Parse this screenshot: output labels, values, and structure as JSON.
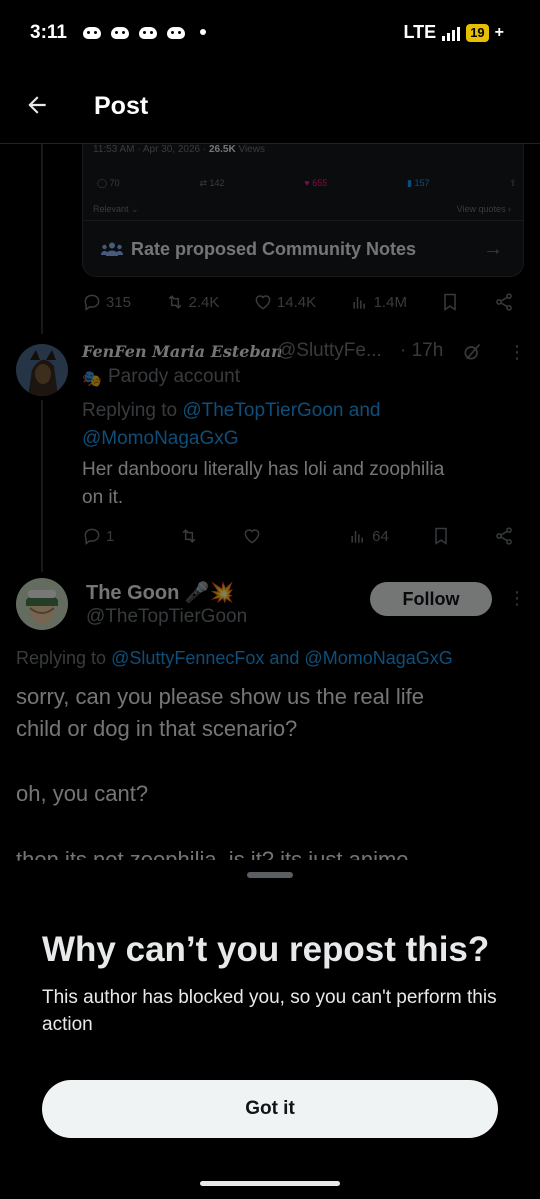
{
  "status_bar": {
    "time": "3:11",
    "network": "LTE",
    "battery": "19",
    "charging": "+"
  },
  "header": {
    "title": "Post"
  },
  "quoted_card": {
    "meta_time": "11:53 AM · Apr 30, 2026 · ",
    "meta_views": "26.5K",
    "meta_views_label": " Views",
    "replies": "70",
    "reposts": "142",
    "likes": "655",
    "bookmarks": "157",
    "relevant": "Relevant ⌄",
    "view_quotes": "View quotes ›",
    "notes_label": "Rate proposed Community Notes"
  },
  "main_post_actions": {
    "replies": "315",
    "reposts": "2.4K",
    "likes": "14.4K",
    "views": "1.4M"
  },
  "reply1": {
    "name": "FenFen Maria Esteban",
    "handle": "@SluttyFe...",
    "time": "· 17h",
    "parody_icon": "🎭",
    "parody_label": "Parody account",
    "replying_prefix": "Replying to ",
    "replying_users": "@TheTopTierGoon and",
    "replying_users2": "@MomoNagaGxG",
    "text_line1": "Her danbooru literally has loli and zoophilia",
    "text_line2": "on it.",
    "replies": "1",
    "views": "64"
  },
  "reply2": {
    "name": "The Goon 🎤💥",
    "handle": "@TheTopTierGoon",
    "follow_label": "Follow",
    "replying_prefix": "Replying to ",
    "replying_users": "@SluttyFennecFox and @MomoNagaGxG",
    "text_line1": "sorry, can you please show us the real life",
    "text_line2": "child or dog in that scenario?",
    "text_line3": "oh, you cant?",
    "text_line4": "then its not zoophilia, is it? its just anime"
  },
  "sheet": {
    "title": "Why can’t you repost this?",
    "body": "This author has blocked you, so you can't perform this action",
    "button": "Got it"
  },
  "colors": {
    "accent": "#1d9bf0",
    "like": "#f91880",
    "background": "#000000",
    "text": "#e7e9ea"
  }
}
